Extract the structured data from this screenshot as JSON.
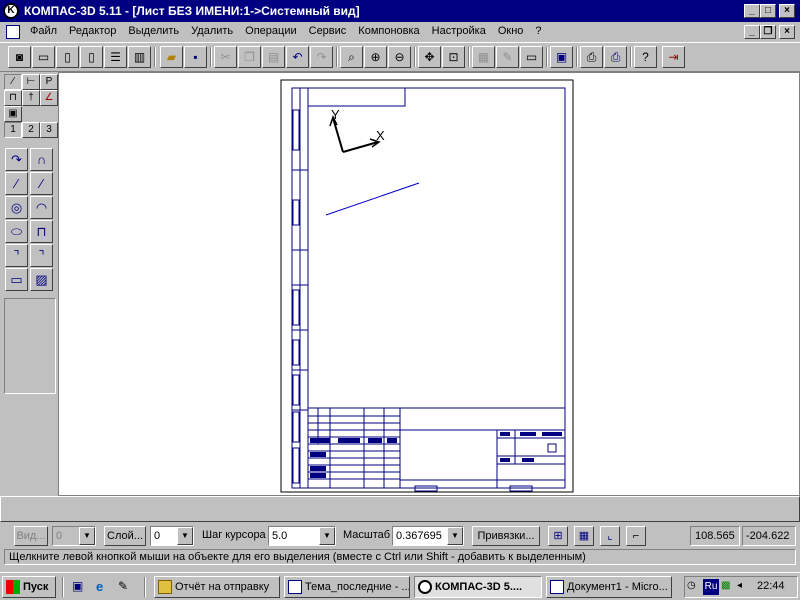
{
  "window": {
    "title": "КОМПАС-3D 5.11 - [Лист БЕЗ ИМЕНИ:1->Системный вид]",
    "controls": {
      "minimize": "_",
      "maximize": "□",
      "close": "×"
    }
  },
  "menu": {
    "items": [
      "Файл",
      "Редактор",
      "Выделить",
      "Удалить",
      "Операции",
      "Сервис",
      "Компоновка",
      "Настройка",
      "Окно",
      "?"
    ]
  },
  "left_panel": {
    "tabs": [
      "1",
      "2",
      "3"
    ]
  },
  "drawing": {
    "axis_x_label": "X",
    "axis_y_label": "Y",
    "line_color": "#0000cc"
  },
  "params_bar": {
    "view_label": "Вид...",
    "view_value": "0",
    "layer_label": "Слой...",
    "layer_value": "0",
    "step_label": "Шаг курсора",
    "step_value": "5.0",
    "scale_label": "Масштаб",
    "scale_value": "0.367695",
    "snaps_label": "Привязки...",
    "coord_x": "108.565",
    "coord_y": "-204.622"
  },
  "hint": {
    "text": "Щелкните левой кнопкой мыши на объекте для его выделения (вместе с Ctrl или Shift - добавить к выделенным)"
  },
  "taskbar": {
    "start_label": "Пуск",
    "tasks": [
      "Отчёт на отправку",
      "Тема_последние - ...",
      "КОМПАС-3D 5....",
      "Документ1 - Micro..."
    ],
    "tray_lang": "Ru",
    "clock": "22:44"
  },
  "colors": {
    "titlebar": "#000080",
    "face": "#c0c0c0",
    "drawing_lines": "#000080"
  }
}
